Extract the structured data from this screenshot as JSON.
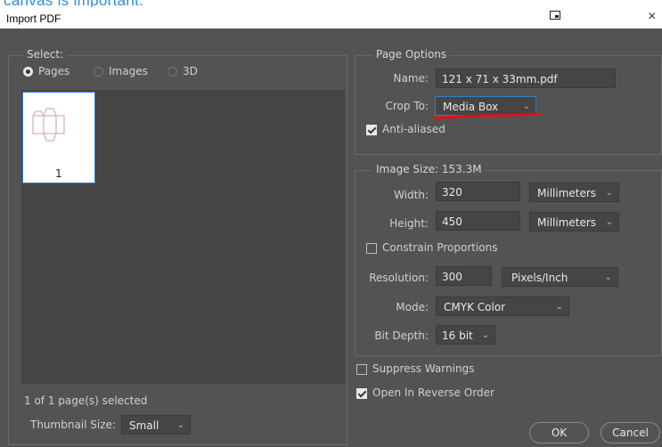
{
  "background_caption": "canvas is important.",
  "window": {
    "title": "Import PDF",
    "close_glyph": "×"
  },
  "select_panel": {
    "legend": "Select:",
    "options": [
      {
        "label": "Pages",
        "selected": true
      },
      {
        "label": "Images",
        "selected": false
      },
      {
        "label": "3D",
        "selected": false
      }
    ],
    "thumbnail_label": "1",
    "status": "1 of 1 page(s) selected",
    "thumb_size_label": "Thumbnail Size:",
    "thumb_size_value": "Small"
  },
  "page_options": {
    "legend": "Page Options",
    "name_label": "Name:",
    "name_value": "121 x 71 x 33mm.pdf",
    "crop_label": "Crop To:",
    "crop_value": "Media Box",
    "antialiased_label": "Anti-aliased",
    "antialiased_checked": true
  },
  "image_size": {
    "legend": "Image Size: 153.3M",
    "width_label": "Width:",
    "width_value": "320",
    "width_unit": "Millimeters",
    "height_label": "Height:",
    "height_value": "450",
    "height_unit": "Millimeters",
    "constrain_label": "Constrain Proportions",
    "constrain_checked": false,
    "resolution_label": "Resolution:",
    "resolution_value": "300",
    "resolution_unit": "Pixels/Inch",
    "mode_label": "Mode:",
    "mode_value": "CMYK Color",
    "bitdepth_label": "Bit Depth:",
    "bitdepth_value": "16 bit"
  },
  "bottom_options": {
    "suppress_label": "Suppress Warnings",
    "suppress_checked": false,
    "reverse_label": "Open In Reverse Order",
    "reverse_checked": true
  },
  "buttons": {
    "ok": "OK",
    "cancel": "Cancel"
  },
  "colors": {
    "dialog_bg": "#535353",
    "list_bg": "#454545",
    "annotation": "#e0101a",
    "caption": "#2a8fd6"
  },
  "icons": {
    "chevron": "chevron-down-icon"
  }
}
